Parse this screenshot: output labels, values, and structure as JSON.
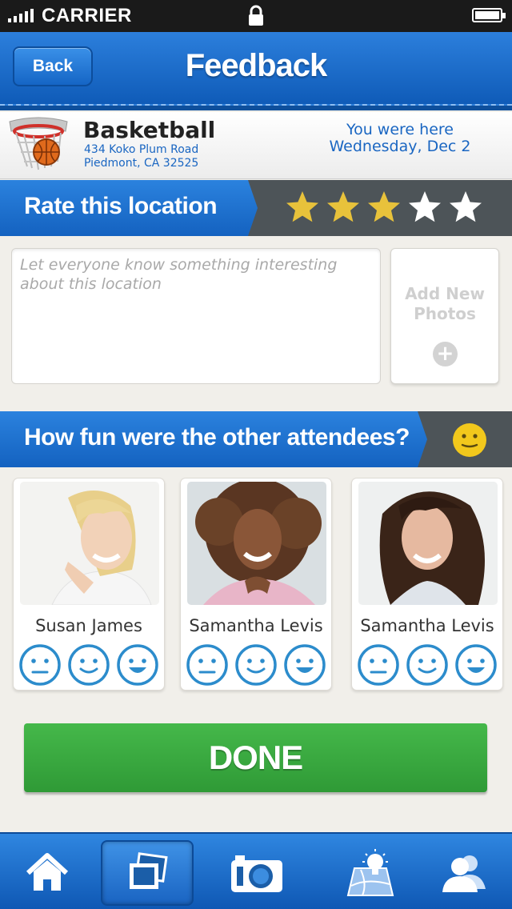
{
  "status": {
    "carrier": "CARRIER",
    "signal_icon": "signal-bars-icon",
    "lock_icon": "lock-icon",
    "battery_icon": "battery-full-icon"
  },
  "nav": {
    "back_label": "Back",
    "title": "Feedback"
  },
  "location": {
    "name": "Basketball",
    "address_line1": "434 Koko Plum Road",
    "address_line2": "Piedmont, CA 32525",
    "visit_line1": "You were here",
    "visit_line2": "Wednesday, Dec 2",
    "icon": "basketball-hoop-icon"
  },
  "rating": {
    "label": "Rate this location",
    "value": 3,
    "max": 5
  },
  "comment": {
    "placeholder": "Let everyone know something interesting about this location",
    "value": ""
  },
  "add_photos": {
    "label": "Add New Photos"
  },
  "attendees_section": {
    "label": "How fun were the other attendees?",
    "mood_icon": "neutral-smiley-icon"
  },
  "attendees": [
    {
      "name": "Susan James"
    },
    {
      "name": "Samantha Levis"
    },
    {
      "name": "Samantha Levis"
    }
  ],
  "done_label": "DONE",
  "tabs": [
    {
      "icon": "home-icon",
      "active": false
    },
    {
      "icon": "photos-icon",
      "active": true
    },
    {
      "icon": "camera-icon",
      "active": false
    },
    {
      "icon": "map-idea-icon",
      "active": false
    },
    {
      "icon": "people-icon",
      "active": false
    }
  ],
  "colors": {
    "brand_blue": "#1a6bd0",
    "done_green": "#3aa940",
    "star_gold": "#e8c23b",
    "face_blue": "#2c8ccc",
    "mood_yellow": "#f2c81c"
  }
}
